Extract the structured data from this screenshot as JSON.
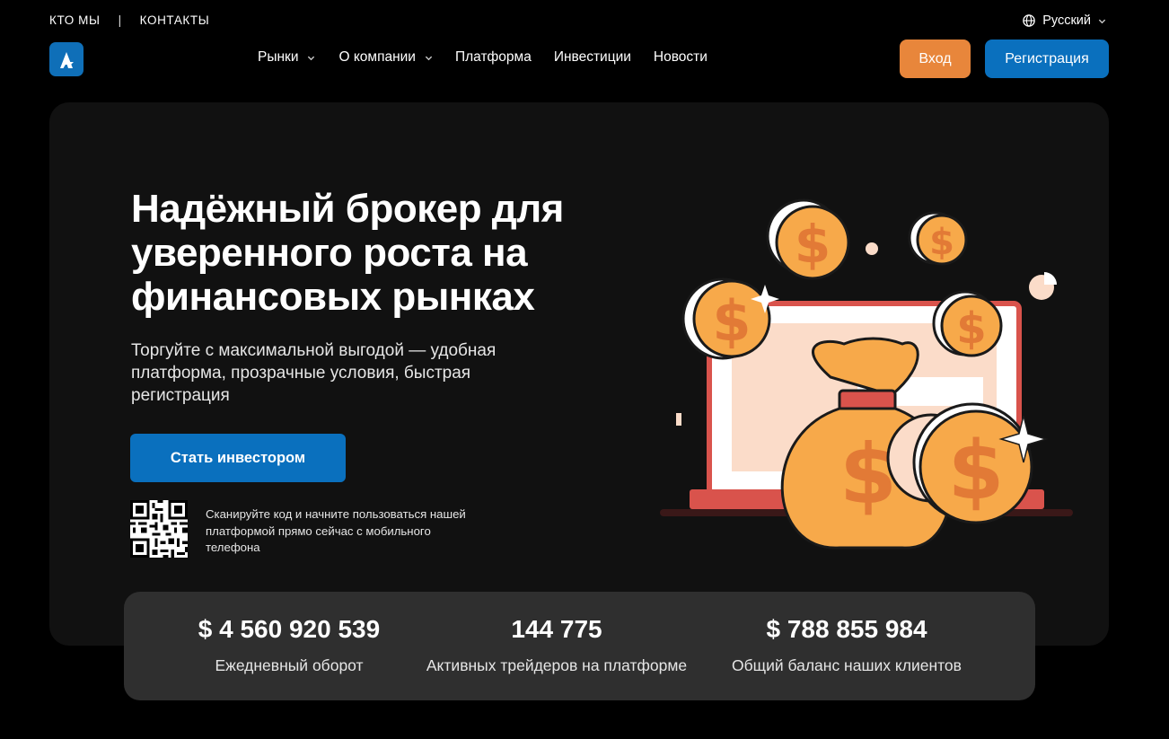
{
  "top_links": {
    "about": "КТО МЫ",
    "separator": "|",
    "contacts": "КОНТАКТЫ"
  },
  "language": {
    "label": "Русский",
    "icon": "globe-icon"
  },
  "nav": {
    "markets": "Рынки",
    "company": "О компании",
    "platform": "Платформа",
    "investments": "Инвестиции",
    "news": "Новости"
  },
  "auth": {
    "login": "Вход",
    "register": "Регистрация"
  },
  "hero": {
    "title": "Надёжный брокер для уверенного роста на финансовых рынках",
    "subtitle": "Торгуйте с максимальной выгодой — удобная платформа, прозрачные условия, быстрая регистрация",
    "cta": "Стать инвестором",
    "qr_text": "Сканируйте код и начните пользоваться нашей платформой прямо сейчас с мобильного телефона"
  },
  "stats": [
    {
      "value": "$ 4 560 920 539",
      "label": "Ежедневный оборот"
    },
    {
      "value": "144 775",
      "label": "Активных трейдеров на платформе"
    },
    {
      "value": "$ 788 855 984",
      "label": "Общий баланс наших клиентов"
    }
  ],
  "colors": {
    "accent_blue": "#0a70be",
    "accent_orange": "#e8863b",
    "coin": "#f7a94a",
    "screen_frame": "#d9534c"
  }
}
